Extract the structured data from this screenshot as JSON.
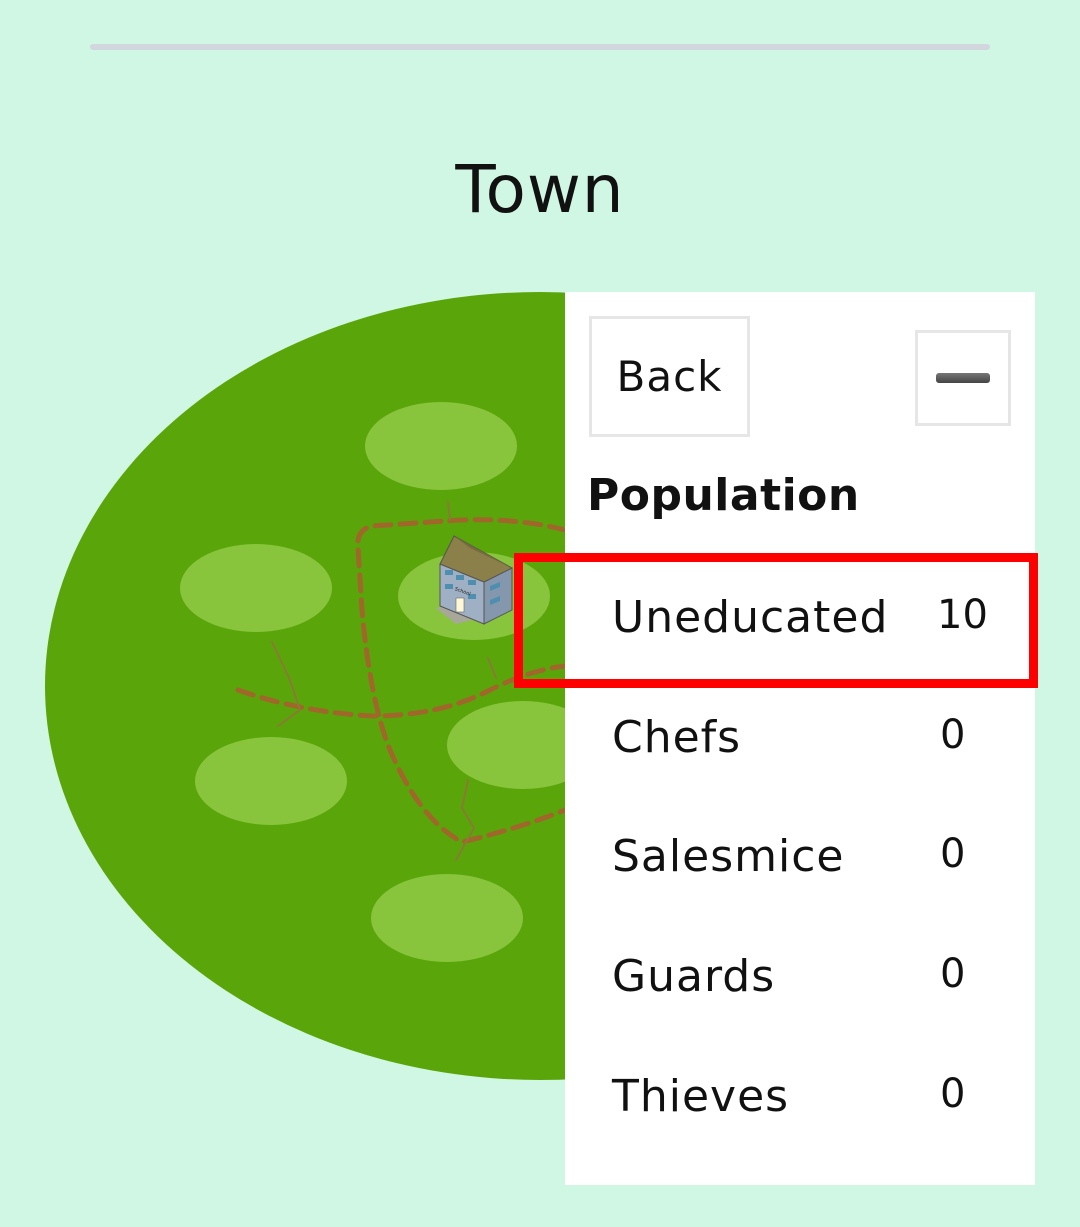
{
  "title": "Town",
  "panel": {
    "back_label": "Back",
    "section_heading": "Population",
    "rows": [
      {
        "label": "Uneducated",
        "value": "10"
      },
      {
        "label": "Chefs",
        "value": "0"
      },
      {
        "label": "Salesmice",
        "value": "0"
      },
      {
        "label": "Guards",
        "value": "0"
      },
      {
        "label": "Thieves",
        "value": "0"
      }
    ],
    "highlighted_row": "Uneducated"
  },
  "map": {
    "school_sign": "School",
    "colors": {
      "ground": "#5aa60a",
      "plot": "#88c53d",
      "path": "#a0672a"
    }
  },
  "colors": {
    "background": "#d0f7e3",
    "highlight": "#ff0000"
  }
}
